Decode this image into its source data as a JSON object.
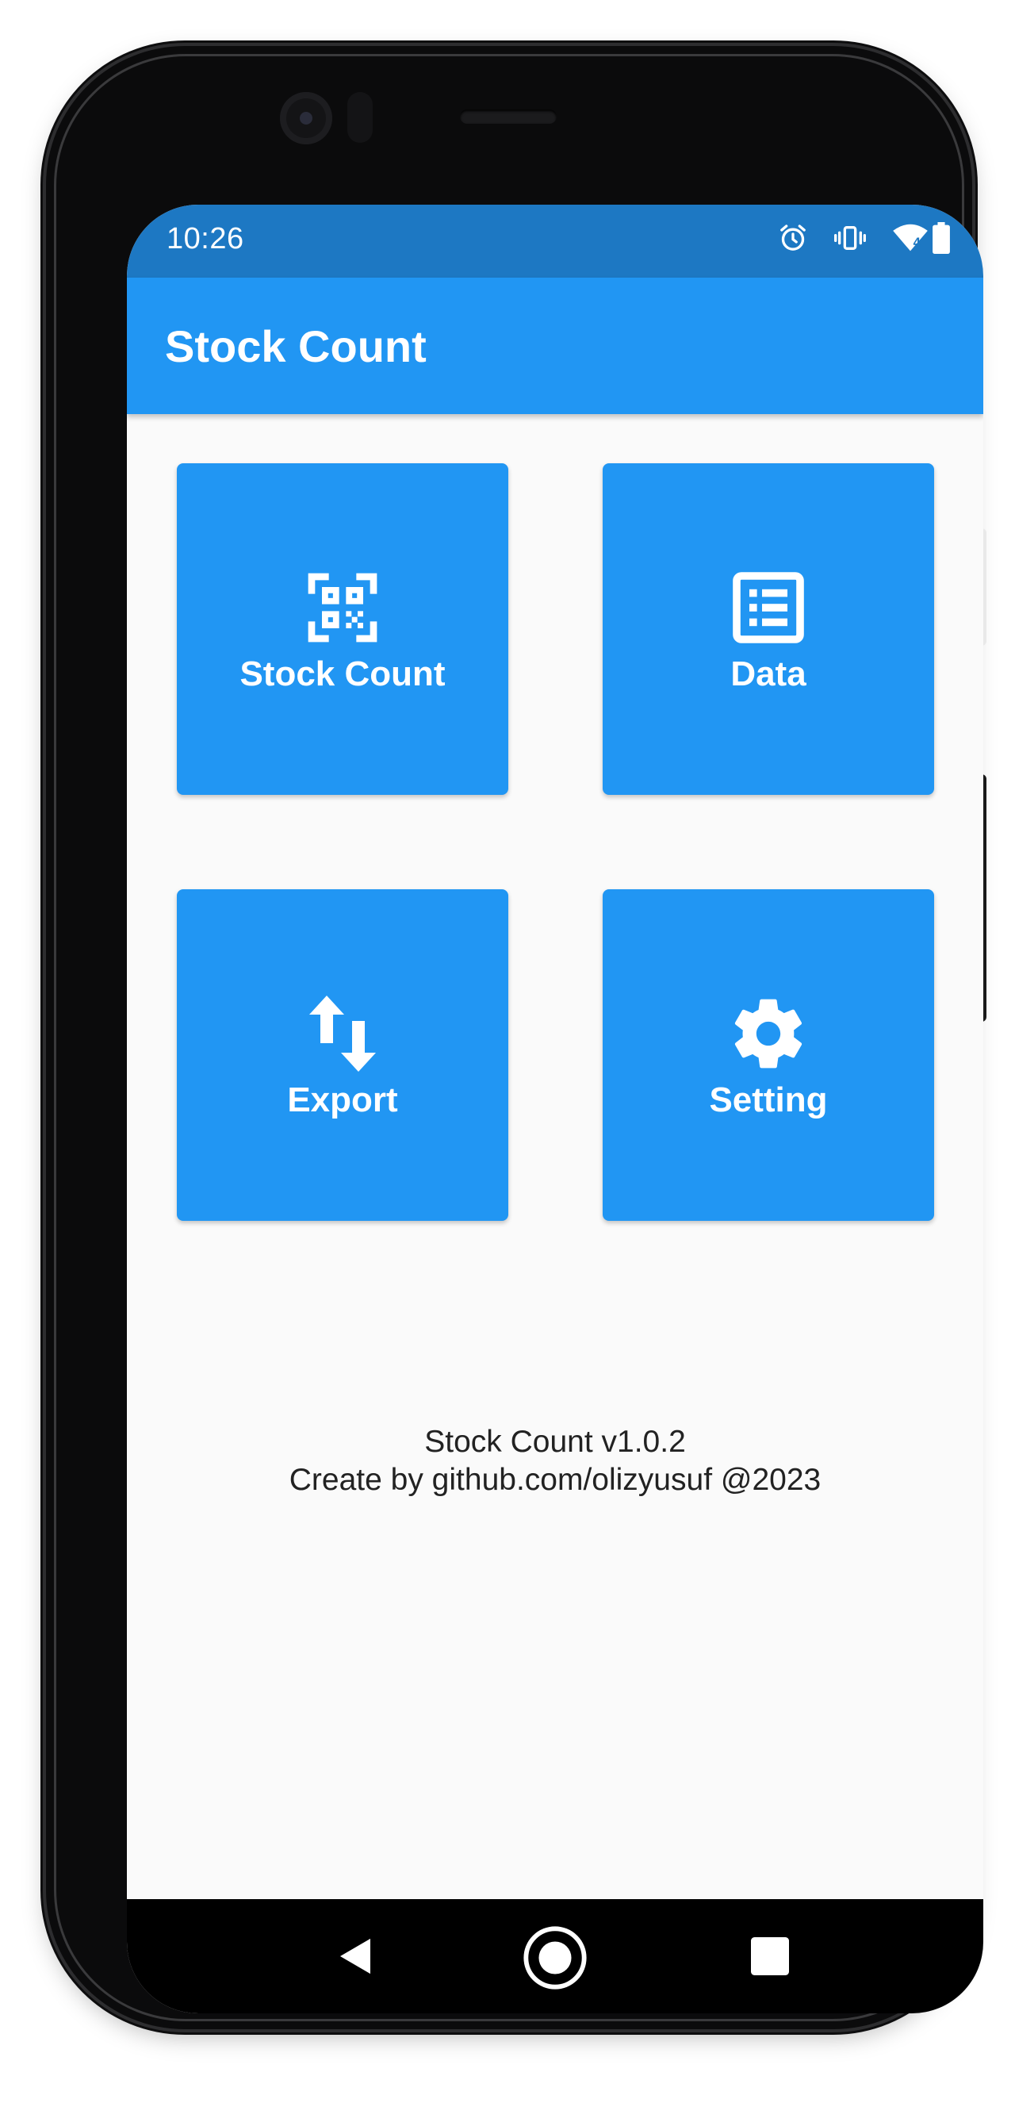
{
  "status_bar": {
    "time": "10:26",
    "icons": [
      "alarm-icon",
      "vibrate-icon",
      "wifi-icon",
      "battery-icon"
    ]
  },
  "app_bar": {
    "title": "Stock Count"
  },
  "menu": {
    "tiles": [
      {
        "label": "Stock Count",
        "icon": "qr-scan-icon"
      },
      {
        "label": "Data",
        "icon": "list-icon"
      },
      {
        "label": "Export",
        "icon": "import-export-icon"
      },
      {
        "label": "Setting",
        "icon": "gear-icon"
      }
    ]
  },
  "footer": {
    "version": "Stock Count v1.0.2",
    "credit": "Create by github.com/olizyusuf @2023"
  },
  "nav_bar": {
    "buttons": [
      "back-icon",
      "home-icon",
      "recents-icon"
    ]
  },
  "colors": {
    "primary": "#2196f3",
    "status_bar": "#1d78c3",
    "background": "#fafafa",
    "nav_bar": "#000000"
  }
}
